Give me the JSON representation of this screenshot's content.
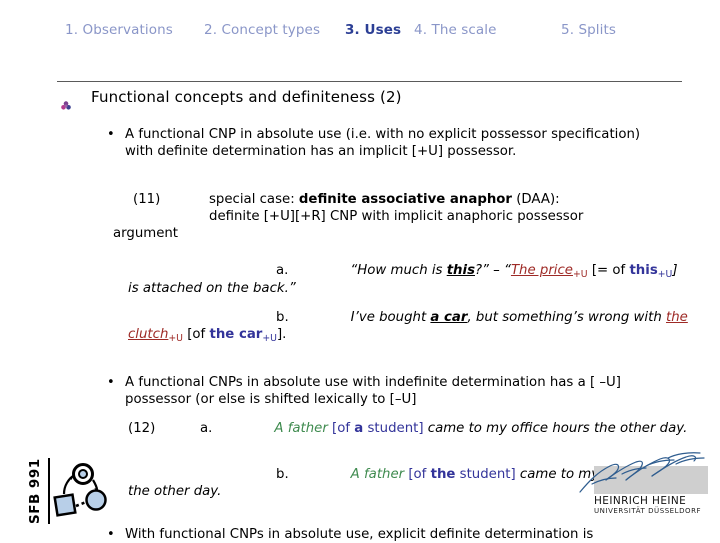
{
  "nav": {
    "items": [
      {
        "label": "1. Observations",
        "active": false
      },
      {
        "label": "2. Concept types",
        "active": false
      },
      {
        "label": "3. Uses",
        "active": true
      },
      {
        "label": "4. The scale",
        "active": false
      },
      {
        "label": "5. Splits",
        "active": false
      }
    ]
  },
  "slide": {
    "title": "Functional concepts and definiteness (2)",
    "bullet_icon": "flower-bullet-icon"
  },
  "body": {
    "bullet1": {
      "marker": "•",
      "line1": "A functional CNP in absolute use (i.e. with no explicit possessor",
      "line2": "specification) with definite determination has an implicit [+U]",
      "line3": "possessor."
    },
    "example11": {
      "number": "(11)",
      "lead": "special case: ",
      "bold": "definite associative anaphor",
      "tail": " (DAA):",
      "line2": "definite [+U][+R] CNP with implicit anaphoric possessor",
      "line3": "argument"
    },
    "example11a": {
      "label": "a.",
      "quote_open": "“How much is ",
      "this_word": "this",
      "quote_mid": "?” – “",
      "the_price": "The price",
      "sub_u1": "+U",
      "bracket": " [= of ",
      "this2": "this",
      "sub_u2": "+U",
      "tail": "] is attached on the back.”"
    },
    "example11b": {
      "label": "b.",
      "lead": "I’ve bought ",
      "a_car": "a car",
      "mid": ", but something’s wrong with ",
      "the_clutch": "the clutch",
      "sub_u1": "+U",
      "bracket_open": " [of ",
      "the_car": "the car",
      "sub_u2": "+U",
      "tail": "]."
    },
    "bullet2": {
      "marker": "•",
      "line1": "A functional CNPs in absolute use with indefinite determination has a [",
      "line2": "–U] possessor (or else is shifted lexically to [–U]"
    },
    "example12a": {
      "number": "(12)",
      "label": "a.",
      "subject": "A father",
      "bracket_open": " [of ",
      "det": "a",
      "noun": " student]",
      "tail": " came to my office hours the other day."
    },
    "example12b": {
      "label": "b.",
      "subject": "A father",
      "bracket_open": " [of ",
      "det": "the",
      "noun": " student]",
      "tail": " came to my office hours the other day."
    },
    "bullet3": {
      "marker": "•",
      "line1": "With functional CNPs in absolute use, explicit definite determination is"
    }
  },
  "logos": {
    "sfb": {
      "label": "SFB 991",
      "icon": "sfb-network-diagram-icon"
    },
    "hhu": {
      "name": "HEINRICH HEINE",
      "subtitle": "UNIVERSITÄT DÜSSELDORF",
      "icon": "heine-signature-icon"
    }
  },
  "colors": {
    "nav_inactive": "#8a96c8",
    "nav_active": "#2c3f95",
    "red_accent": "#9e2a26",
    "blue_accent": "#33349a",
    "green_accent": "#3f8b4f"
  }
}
